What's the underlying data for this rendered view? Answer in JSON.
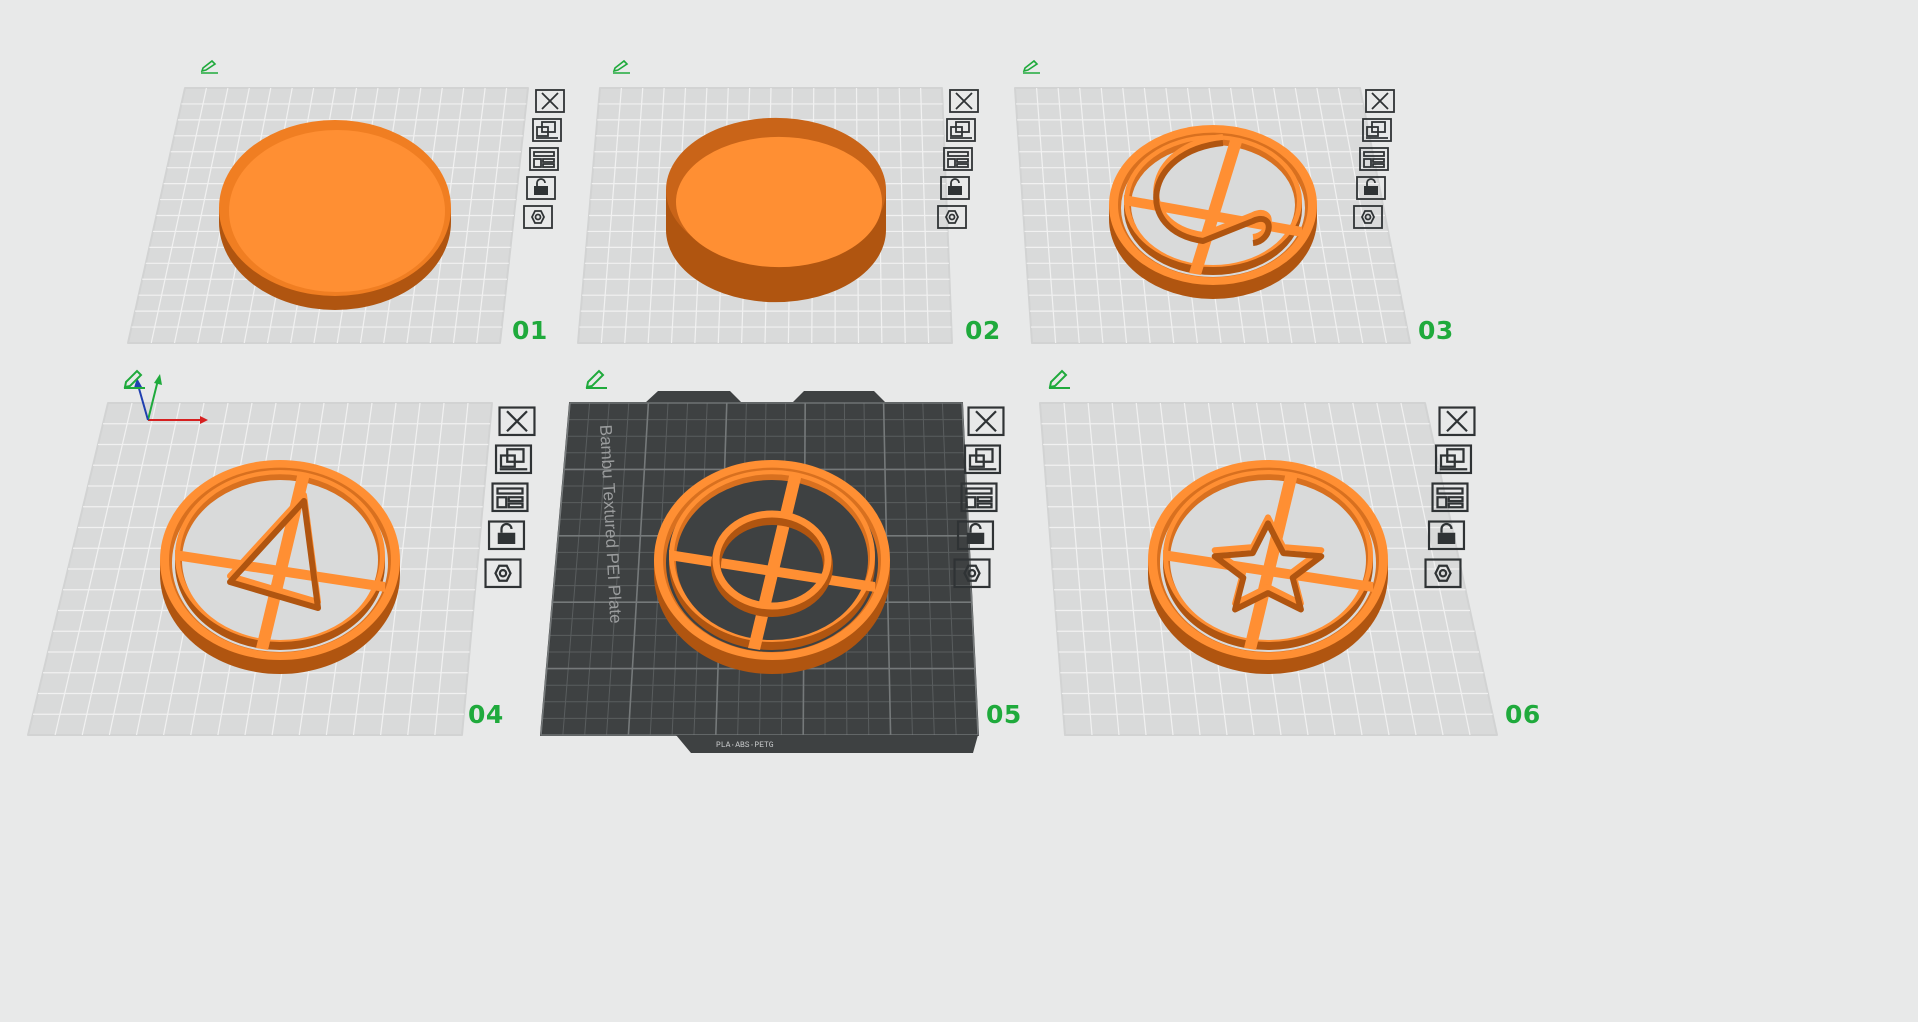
{
  "app": {
    "accent_color": "#1faa3c",
    "model_color": "#ff8f33"
  },
  "plates": [
    {
      "number": "01",
      "model": "disc",
      "active": false,
      "edit_icon": "pencil-icon"
    },
    {
      "number": "02",
      "model": "cup",
      "active": false,
      "edit_icon": "pencil-icon"
    },
    {
      "number": "03",
      "model": "cutter-loop",
      "active": false,
      "edit_icon": "pencil-icon"
    },
    {
      "number": "04",
      "model": "cutter-triangle",
      "active": false,
      "edit_icon": "pencil-icon"
    },
    {
      "number": "05",
      "model": "cutter-circle",
      "active": true,
      "edit_icon": "pencil-icon"
    },
    {
      "number": "06",
      "model": "cutter-star",
      "active": false,
      "edit_icon": "pencil-icon"
    }
  ],
  "plate_toolbar": [
    {
      "name": "close-icon",
      "action": "delete plate"
    },
    {
      "name": "arrange-icon",
      "action": "arrange plate"
    },
    {
      "name": "orient-icon",
      "action": "auto orient"
    },
    {
      "name": "lock-icon",
      "action": "lock plate"
    },
    {
      "name": "plate-settings-icon",
      "action": "plate settings"
    }
  ],
  "active_bed": {
    "label": "Bambu Textured PEI Plate",
    "footer_text": "PLA·ABS·PETG",
    "color": "#3e4142"
  },
  "axes": {
    "x_color": "#d62020",
    "y_color": "#1faa3c",
    "z_color": "#2040b0"
  }
}
